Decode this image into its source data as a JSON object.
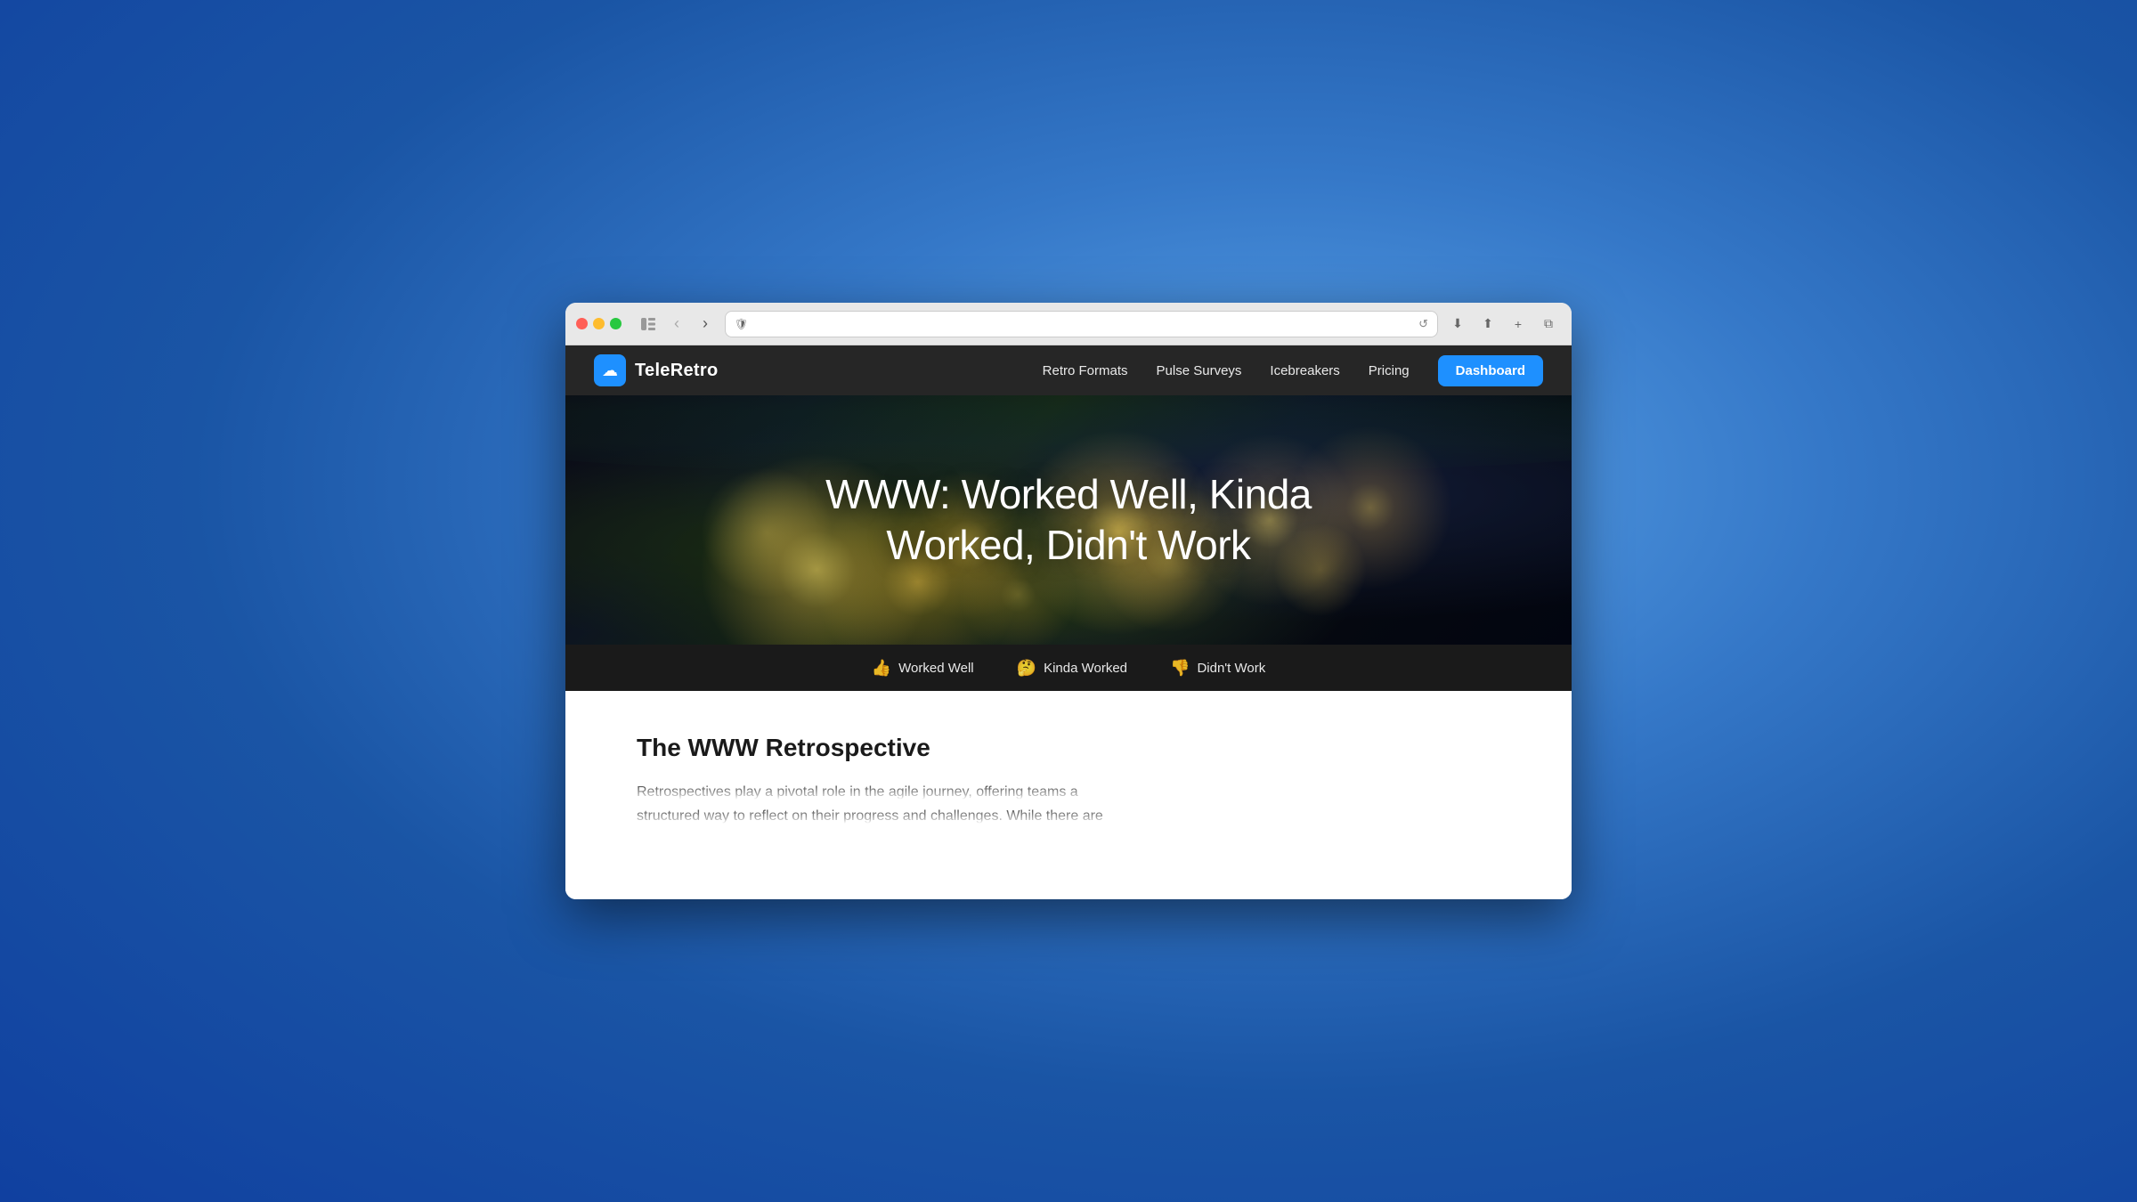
{
  "browser": {
    "address": "",
    "reload_symbol": "↺",
    "back_symbol": "‹",
    "forward_symbol": "›",
    "download_symbol": "⬇",
    "share_symbol": "⬆",
    "add_tab_symbol": "+",
    "tabs_symbol": "⧉",
    "sidebar_symbol": "⊡"
  },
  "nav": {
    "logo_text": "TeleRetro",
    "logo_icon": "☁",
    "links": [
      {
        "label": "Retro Formats"
      },
      {
        "label": "Pulse Surveys"
      },
      {
        "label": "Icebreakers"
      },
      {
        "label": "Pricing"
      }
    ],
    "cta_label": "Dashboard"
  },
  "hero": {
    "title_line1": "WWW: Worked Well, Kinda",
    "title_line2": "Worked, Didn't Work"
  },
  "tabs": [
    {
      "emoji": "👍",
      "label": "Worked Well"
    },
    {
      "emoji": "🤔",
      "label": "Kinda Worked"
    },
    {
      "emoji": "👎",
      "label": "Didn't Work"
    }
  ],
  "content": {
    "title": "The WWW Retrospective",
    "body_line1": "Retrospectives play a pivotal role in the agile journey, offering teams a",
    "body_line2": "structured way to reflect on their progress and challenges. While there are"
  }
}
